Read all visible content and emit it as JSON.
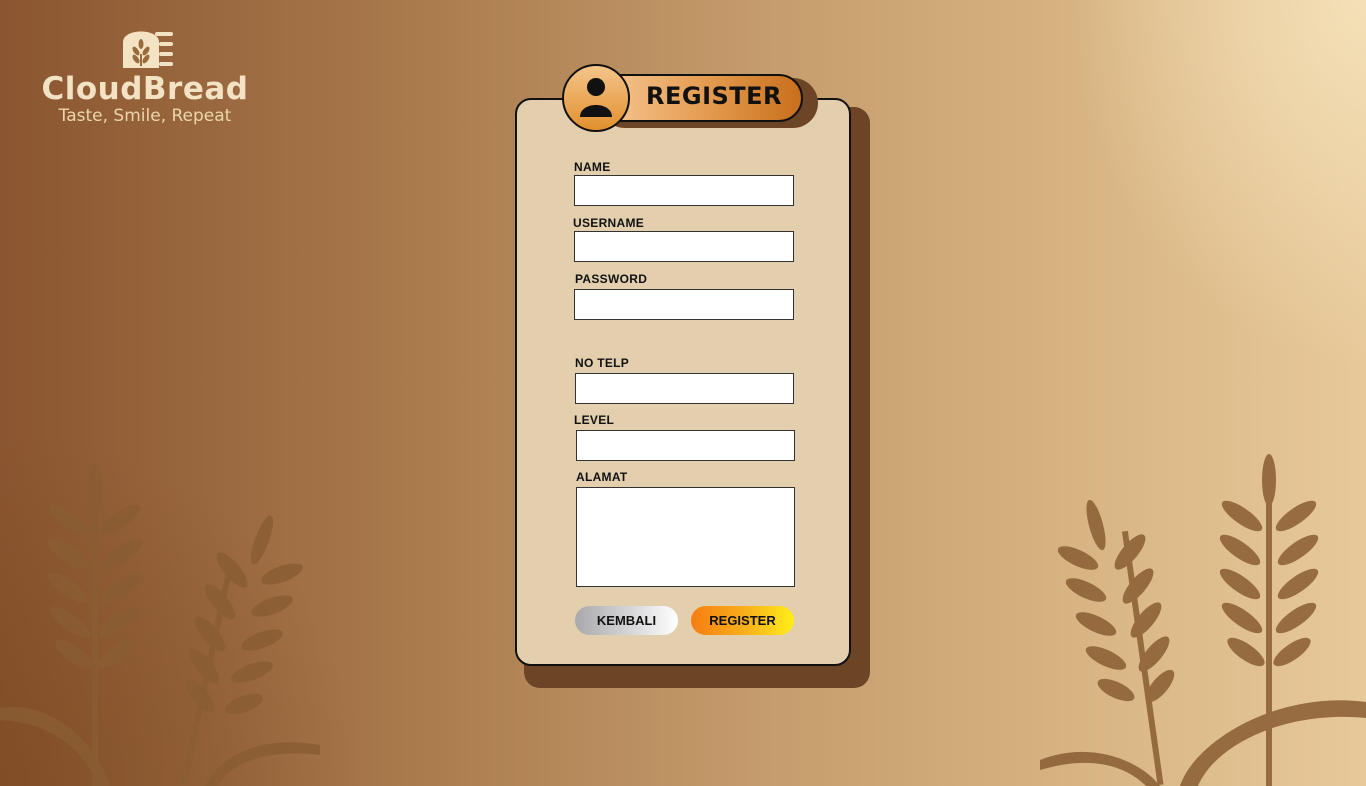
{
  "brand": {
    "name": "CloudBread",
    "tagline": "Taste, Smile, Repeat"
  },
  "form": {
    "title": "REGISTER",
    "fields": {
      "name": {
        "label": "NAME",
        "value": ""
      },
      "username": {
        "label": "USERNAME",
        "value": ""
      },
      "password": {
        "label": "PASSWORD",
        "value": ""
      },
      "phone": {
        "label": "NO TELP",
        "value": ""
      },
      "level": {
        "label": "LEVEL",
        "value": ""
      },
      "address": {
        "label": "ALAMAT",
        "value": ""
      }
    },
    "buttons": {
      "back": "KEMBALI",
      "register": "REGISTER"
    }
  },
  "colors": {
    "card": "#e3ceae",
    "card_shadow": "#6b4526",
    "wheat": "#8a5d33",
    "brand_text": "#f3e3c4"
  },
  "icons": {
    "logo": "bread-wheat-icon",
    "avatar": "user-icon",
    "decor": "wheat-icon"
  }
}
